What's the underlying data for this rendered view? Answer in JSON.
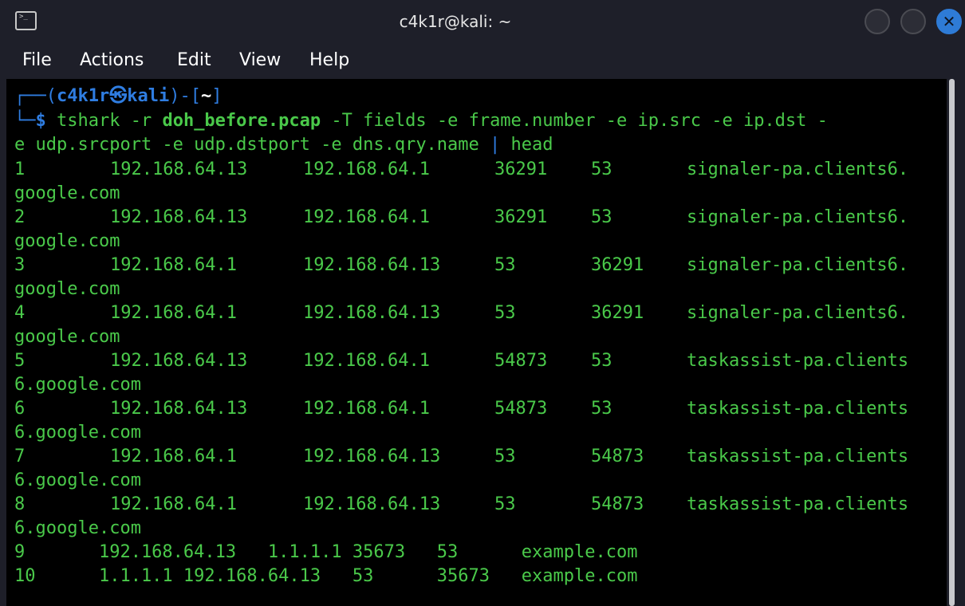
{
  "window": {
    "title": "c4k1r@kali: ~"
  },
  "menu": {
    "items": [
      "File",
      "Actions",
      "Edit",
      "View",
      "Help"
    ]
  },
  "prompt": {
    "line1_open": "┌──(",
    "user_host": "c4k1r㉿kali",
    "line1_mid": ")-[",
    "dir": "~",
    "line1_close": "]",
    "line2_prefix": "└─",
    "dollar": "$"
  },
  "command": {
    "part1": " tshark -r ",
    "file": "doh_before.pcap",
    "part2": " -T fields -e frame.number -e ip.src -e ip.dst -",
    "part3": "e udp.srcport -e udp.dstport -e dns.qry.name ",
    "pipe": "|",
    "part4": " head"
  },
  "output_rows": [
    {
      "frame": "1",
      "src": "192.168.64.13",
      "dst": "192.168.64.1",
      "sport": "36291",
      "dport": "53",
      "name_a": "signaler-pa.clients6.",
      "name_b": "google.com"
    },
    {
      "frame": "2",
      "src": "192.168.64.13",
      "dst": "192.168.64.1",
      "sport": "36291",
      "dport": "53",
      "name_a": "signaler-pa.clients6.",
      "name_b": "google.com"
    },
    {
      "frame": "3",
      "src": "192.168.64.1",
      "dst": "192.168.64.13",
      "sport": "53",
      "dport": "36291",
      "name_a": "signaler-pa.clients6.",
      "name_b": "google.com"
    },
    {
      "frame": "4",
      "src": "192.168.64.1",
      "dst": "192.168.64.13",
      "sport": "53",
      "dport": "36291",
      "name_a": "signaler-pa.clients6.",
      "name_b": "google.com"
    },
    {
      "frame": "5",
      "src": "192.168.64.13",
      "dst": "192.168.64.1",
      "sport": "54873",
      "dport": "53",
      "name_a": "taskassist-pa.clients",
      "name_b": "6.google.com"
    },
    {
      "frame": "6",
      "src": "192.168.64.13",
      "dst": "192.168.64.1",
      "sport": "54873",
      "dport": "53",
      "name_a": "taskassist-pa.clients",
      "name_b": "6.google.com"
    },
    {
      "frame": "7",
      "src": "192.168.64.1",
      "dst": "192.168.64.13",
      "sport": "53",
      "dport": "54873",
      "name_a": "taskassist-pa.clients",
      "name_b": "6.google.com"
    },
    {
      "frame": "8",
      "src": "192.168.64.1",
      "dst": "192.168.64.13",
      "sport": "53",
      "dport": "54873",
      "name_a": "taskassist-pa.clients",
      "name_b": "6.google.com"
    }
  ],
  "short_rows": [
    {
      "text": "9       192.168.64.13   1.1.1.1 35673   53      example.com"
    },
    {
      "text": "10      1.1.1.1 192.168.64.13   53      35673   example.com"
    }
  ],
  "colors": {
    "prompt_blue": "#2f7de1",
    "output_green": "#4ac94a",
    "close_button": "#2e7bd6"
  }
}
